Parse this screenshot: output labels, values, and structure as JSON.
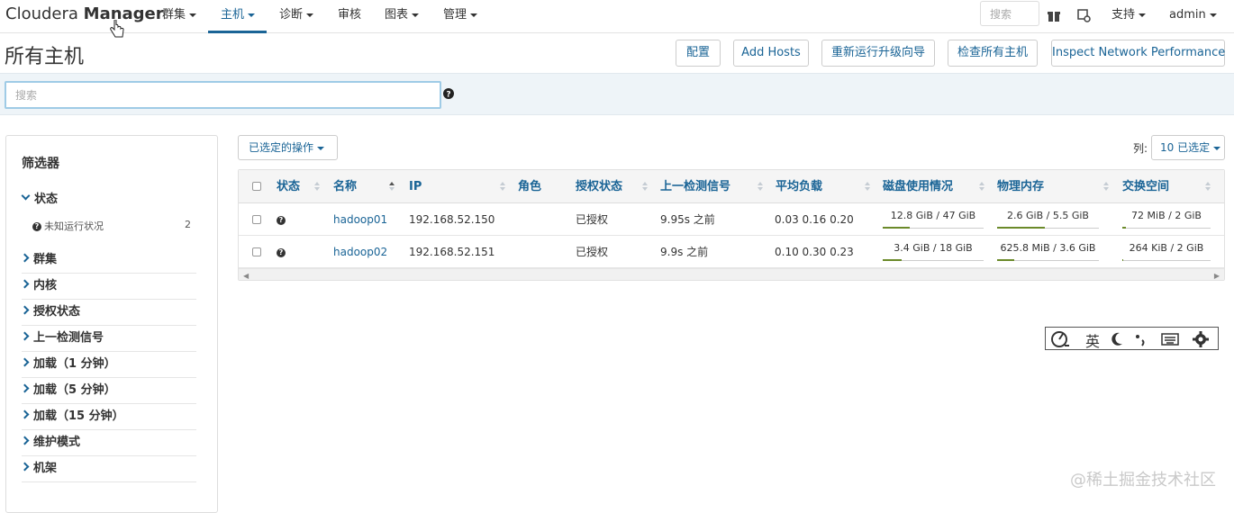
{
  "app": {
    "brand_light": "Cloudera",
    "brand_bold": "Manager"
  },
  "nav": {
    "items": [
      {
        "label": "群集"
      },
      {
        "label": "主机"
      },
      {
        "label": "诊断"
      },
      {
        "label": "审核"
      },
      {
        "label": "图表"
      },
      {
        "label": "管理"
      }
    ],
    "search_placeholder": "搜索",
    "support_label": "支持",
    "user_label": "admin"
  },
  "page": {
    "title": "所有主机",
    "buttons": [
      "配置",
      "Add Hosts",
      "重新运行升级向导",
      "检查所有主机",
      "Inspect Network Performance"
    ]
  },
  "search": {
    "placeholder": "搜索"
  },
  "filters": {
    "title": "筛选器",
    "status_group": "状态",
    "status_item": {
      "label": "未知运行状况",
      "count": "2"
    },
    "groups": [
      "群集",
      "内核",
      "授权状态",
      "上一检测信号",
      "加载（1 分钟）",
      "加载（5 分钟）",
      "加载（15 分钟）",
      "维护模式",
      "机架"
    ]
  },
  "actions": {
    "selected_label": "已选定的操作",
    "cols_label": "列:",
    "cols_button": "10 已选定"
  },
  "table": {
    "headers": [
      "状态",
      "名称",
      "IP",
      "角色",
      "授权状态",
      "上一检测信号",
      "平均负载",
      "磁盘使用情况",
      "物理内存",
      "交换空间"
    ],
    "rows": [
      {
        "name": "hadoop01",
        "ip": "192.168.52.150",
        "auth": "已授权",
        "heartbeat": "9.95s 之前",
        "load": "0.03  0.16  0.20",
        "disk": "12.8 GiB / 47 GiB",
        "disk_pct": 27,
        "mem": "2.6 GiB / 5.5 GiB",
        "mem_pct": 47,
        "swap": "72 MiB / 2 GiB",
        "swap_pct": 4
      },
      {
        "name": "hadoop02",
        "ip": "192.168.52.151",
        "auth": "已授权",
        "heartbeat": "9.9s 之前",
        "load": "0.10  0.30  0.23",
        "disk": "3.4 GiB / 18 GiB",
        "disk_pct": 19,
        "mem": "625.8 MiB / 3.6 GiB",
        "mem_pct": 17,
        "swap": "264 KiB / 2 GiB",
        "swap_pct": 0
      }
    ]
  },
  "ime": {
    "lang": "英"
  },
  "watermark": "@稀土掘金技术社区",
  "colors": {
    "link": "#1a6496",
    "meter_fill": "#6b8a2a",
    "band": "#eef4f8"
  }
}
